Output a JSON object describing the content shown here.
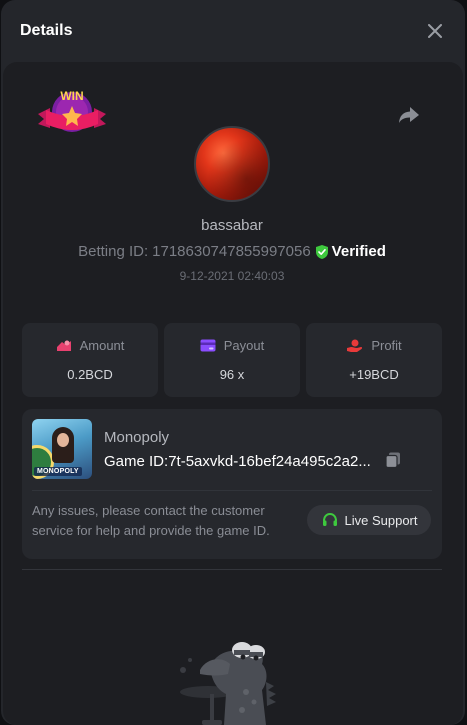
{
  "modal": {
    "title": "Details"
  },
  "player": {
    "username": "bassabar",
    "betting_label": "Betting ID:",
    "betting_id": "1718630747855997056",
    "verified_label": "Verified",
    "timestamp": "9-12-2021 02:40:03"
  },
  "stats": [
    {
      "label": "Amount",
      "value": "0.2BCD",
      "icon": "amount-icon",
      "color": "#e8416f"
    },
    {
      "label": "Payout",
      "value": "96 x",
      "icon": "payout-card-icon",
      "color": "#8a4dff"
    },
    {
      "label": "Profit",
      "value": "+19BCD",
      "icon": "profit-hand-icon",
      "color": "#e83a3a"
    }
  ],
  "game": {
    "name": "Monopoly",
    "thumb_logo": "MONOPOLY",
    "game_id_label": "Game ID:",
    "game_id": "7t-5axvkd-16bef24a495c2a2..."
  },
  "support": {
    "message": "Any issues, please contact the customer service for help and provide the game ID.",
    "button_label": "Live Support"
  },
  "badge": {
    "text": "WIN"
  },
  "colors": {
    "verified_green": "#3ec93e",
    "support_green": "#3ec93e"
  }
}
